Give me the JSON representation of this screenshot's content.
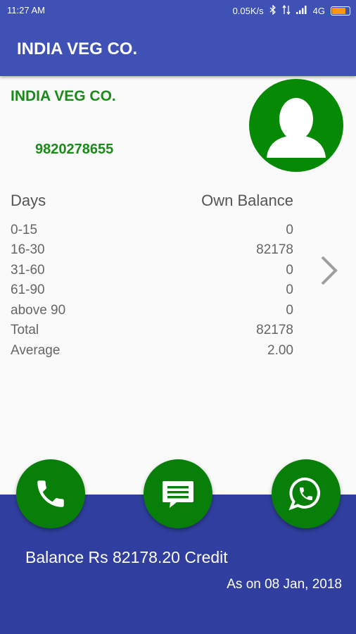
{
  "status_bar": {
    "time": "11:27 AM",
    "speed": "0.05K/s",
    "network": "4G",
    "battery_level": 0.9
  },
  "app_bar": {
    "title": "INDIA VEG CO."
  },
  "party": {
    "name": "INDIA VEG CO.",
    "phone": "9820278655"
  },
  "table": {
    "headers": {
      "days": "Days",
      "balance": "Own Balance"
    },
    "rows": [
      {
        "days": "0-15",
        "value": "0"
      },
      {
        "days": "16-30",
        "value": "82178"
      },
      {
        "days": "31-60",
        "value": "0"
      },
      {
        "days": "61-90",
        "value": "0"
      },
      {
        "days": "above 90",
        "value": "0"
      },
      {
        "days": "Total",
        "value": "82178"
      },
      {
        "days": "Average",
        "value": "2.00"
      }
    ]
  },
  "actions": [
    "phone-icon",
    "message-icon",
    "whatsapp-icon"
  ],
  "footer": {
    "balance": "Balance Rs 82178.20 Credit",
    "as_on": "As on 08 Jan, 2018"
  },
  "colors": {
    "primary": "#3f51b5",
    "primary_dark": "#303f9f",
    "green": "#087f08",
    "text_green": "#1b8a1b"
  }
}
